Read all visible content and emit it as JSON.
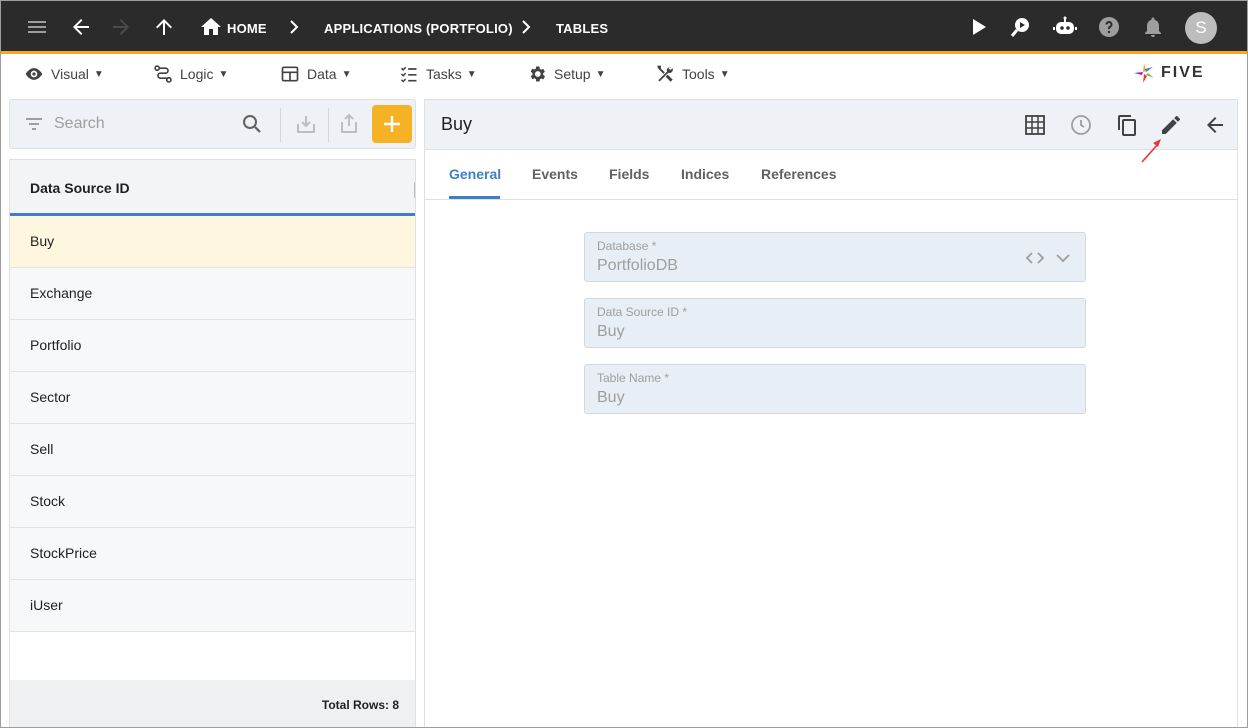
{
  "topbar": {
    "breadcrumbs": [
      "HOME",
      "APPLICATIONS (PORTFOLIO)",
      "TABLES"
    ],
    "avatar_initial": "S",
    "accent_color": "#f5a623",
    "icons": [
      "menu-icon",
      "back-arrow-icon",
      "forward-arrow-icon",
      "up-arrow-icon",
      "home-icon",
      "play-icon",
      "search-chat-icon",
      "bot-icon",
      "help-icon",
      "bell-icon"
    ]
  },
  "menubar": {
    "items": [
      {
        "label": "Visual",
        "icon": "eye-icon"
      },
      {
        "label": "Logic",
        "icon": "logic-flow-icon"
      },
      {
        "label": "Data",
        "icon": "table-grid-icon"
      },
      {
        "label": "Tasks",
        "icon": "checklist-icon"
      },
      {
        "label": "Setup",
        "icon": "gear-icon"
      },
      {
        "label": "Tools",
        "icon": "tools-icon"
      }
    ],
    "caret": "▼",
    "logo_text": "FIVE"
  },
  "left": {
    "search_placeholder": "Search",
    "add_label": "+",
    "add_color": "#f5b225",
    "column_header": "Data Source ID",
    "rows": [
      "Buy",
      "Exchange",
      "Portfolio",
      "Sector",
      "Sell",
      "Stock",
      "StockPrice",
      "iUser"
    ],
    "selected_row": "Buy",
    "footer": "Total Rows: 8"
  },
  "right": {
    "title": "Buy",
    "tabs": [
      "General",
      "Events",
      "Fields",
      "Indices",
      "References"
    ],
    "active_tab": "General",
    "active_color": "#3f7fc4",
    "fields": [
      {
        "label": "Database *",
        "value": "PortfolioDB"
      },
      {
        "label": "Data Source ID *",
        "value": "Buy"
      },
      {
        "label": "Table Name *",
        "value": "Buy"
      }
    ],
    "header_icons": [
      "grid-view-icon",
      "history-icon",
      "copy-icon",
      "edit-pencil-icon",
      "back-arrow-icon"
    ]
  }
}
